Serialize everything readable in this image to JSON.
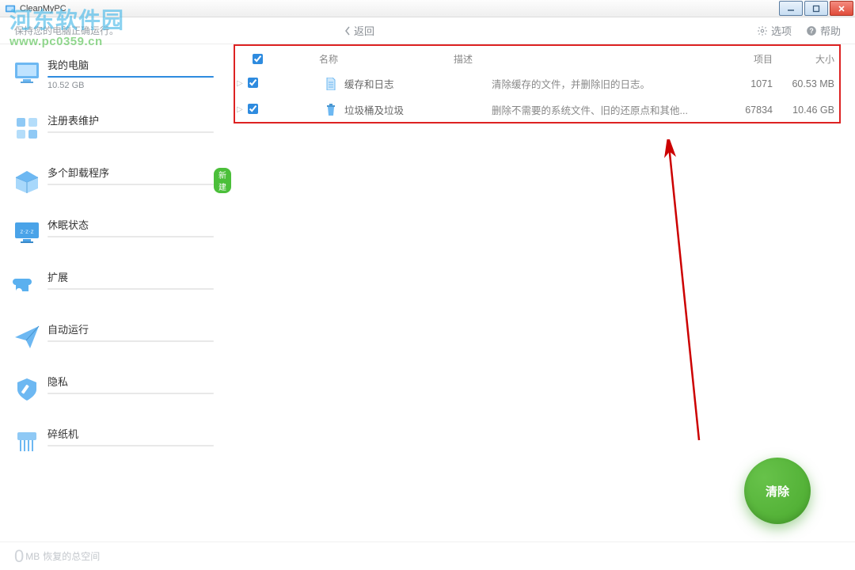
{
  "titlebar": {
    "title": "CleanMyPC"
  },
  "header": {
    "subtitle": "保持您的电脑正确运行。",
    "back": "返回",
    "options": "选项",
    "help": "帮助"
  },
  "watermark": {
    "line1": "河东软件园",
    "line2": "www.pc0359.cn"
  },
  "sidebar": {
    "items": [
      {
        "label": "我的电脑",
        "extra": "10.52 GB"
      },
      {
        "label": "注册表维护"
      },
      {
        "label": "多个卸载程序",
        "badge": "新建"
      },
      {
        "label": "休眠状态"
      },
      {
        "label": "扩展"
      },
      {
        "label": "自动运行"
      },
      {
        "label": "隐私"
      },
      {
        "label": "碎纸机"
      }
    ]
  },
  "table": {
    "headers": {
      "name": "名称",
      "desc": "描述",
      "items": "项目",
      "size": "大小"
    },
    "rows": [
      {
        "name": "缓存和日志",
        "desc": "清除缓存的文件，并删除旧的日志。",
        "items": "1071",
        "size": "60.53 MB"
      },
      {
        "name": "垃圾桶及垃圾",
        "desc": "删除不需要的系统文件、旧的还原点和其他...",
        "items": "67834",
        "size": "10.46 GB"
      }
    ]
  },
  "clean_button": "清除",
  "footer": {
    "big": "0",
    "unit": "MB",
    "text": "恢复的总空间"
  }
}
